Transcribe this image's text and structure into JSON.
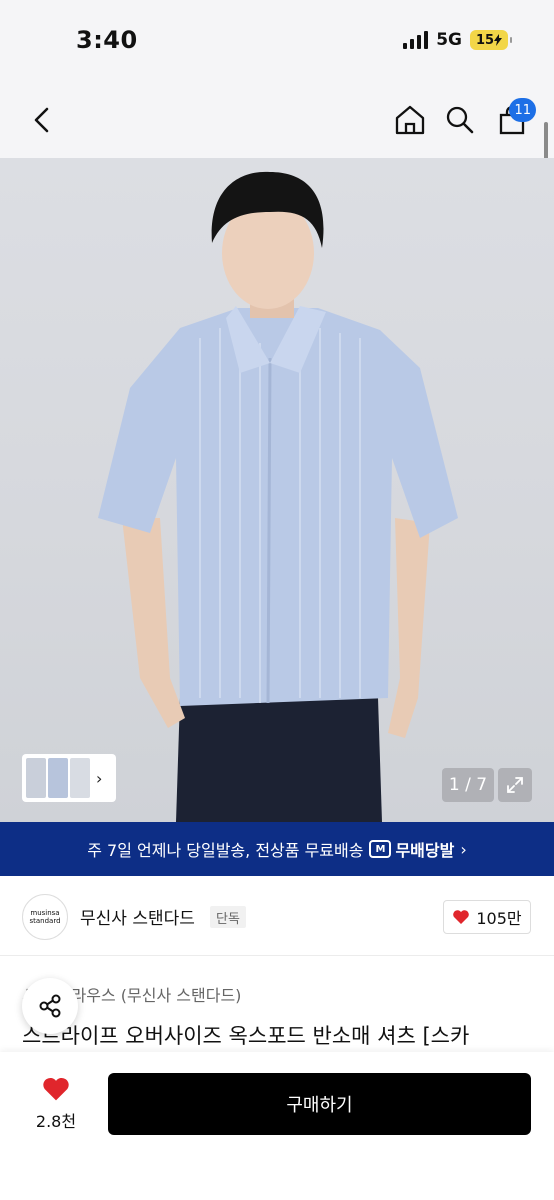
{
  "status_bar": {
    "time": "3:40",
    "network": "5G",
    "battery": "15"
  },
  "nav": {
    "cart_count": "11"
  },
  "gallery": {
    "counter": "1 / 7"
  },
  "shipping_banner": {
    "text": "주 7일 언제나 당일발송, 전상품 무료배송",
    "logo_label": "무배당발",
    "logo_mark": "M"
  },
  "brand": {
    "logo_line1": "musinsa",
    "logo_line2": "standard",
    "name": "무신사 스탠다드",
    "badge": "단독",
    "likes": "105만"
  },
  "product": {
    "category": "셔츠/블라우스 (무신사 스탠다드)",
    "title": "스트라이프 오버사이즈 옥스포드 반소매 셔츠 [스카"
  },
  "bottom": {
    "wish_count": "2.8천",
    "buy_label": "구매하기"
  },
  "colors": {
    "accent_blue": "#1d6fe6",
    "banner_navy": "#0d2e86",
    "heart_red": "#e0262c",
    "buy_black": "#000000",
    "battery_yellow": "#f2d648"
  }
}
